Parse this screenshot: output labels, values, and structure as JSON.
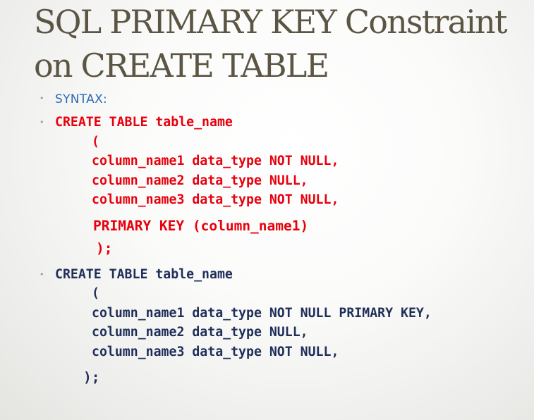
{
  "slide": {
    "title_line1": "SQL PRIMARY KEY Constraint",
    "title_line2": "on CREATE TABLE",
    "bullet_symbol": "•",
    "syntax_label": "SYNTAX:",
    "example1": {
      "line1": "CREATE TABLE table_name",
      "line2": "(",
      "line3": "column_name1 data_type NOT NULL,",
      "line4": "column_name2 data_type NULL,",
      "line5": "column_name3 data_type NOT NULL,",
      "line6": "PRIMARY KEY (column_name1)",
      "line7": ");"
    },
    "example2": {
      "line1": "CREATE TABLE table_name",
      "line2": "(",
      "line3": "column_name1 data_type NOT NULL PRIMARY KEY,",
      "line4": "column_name2 data_type NULL,",
      "line5": "column_name3 data_type NOT NULL,",
      "line6": ");"
    },
    "colors": {
      "title": "#5c5544",
      "syntax_label": "#2b6cb0",
      "example1_code": "#e8000d",
      "example2_code": "#1f2f5a",
      "bullet": "#9a9a8a"
    }
  }
}
